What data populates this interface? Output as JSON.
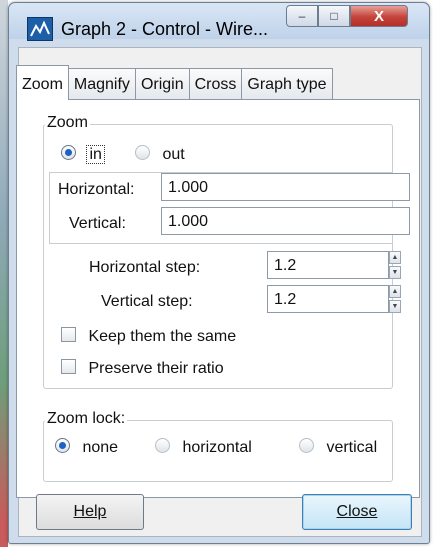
{
  "window": {
    "title": "Graph 2 - Control - Wire...",
    "controls": {
      "minimize": "–",
      "maximize": "□",
      "close": "X"
    }
  },
  "tabs": [
    {
      "label": "Zoom",
      "active": true
    },
    {
      "label": "Magnify",
      "active": false
    },
    {
      "label": "Origin",
      "active": false
    },
    {
      "label": "Cross",
      "active": false
    },
    {
      "label": "Graph type",
      "active": false
    }
  ],
  "zoom_group": {
    "legend": "Zoom",
    "direction": {
      "in_label": "in",
      "out_label": "out",
      "selected": "in"
    },
    "horizontal": {
      "label": "Horizontal:",
      "value": "1.000"
    },
    "vertical": {
      "label": "Vertical:",
      "value": "1.000"
    },
    "horizontal_step": {
      "label": "Horizontal step:",
      "value": "1.2"
    },
    "vertical_step": {
      "label": "Vertical step:",
      "value": "1.2"
    },
    "keep_same": {
      "label": "Keep them the same",
      "checked": false
    },
    "preserve_ratio": {
      "label": "Preserve their ratio",
      "checked": false
    }
  },
  "zoom_lock": {
    "legend": "Zoom lock:",
    "options": {
      "none": "none",
      "horizontal": "horizontal",
      "vertical": "vertical"
    },
    "selected": "none"
  },
  "buttons": {
    "help": "Help",
    "close": "Close"
  },
  "colors": {
    "accent_radio": "#1d60c8",
    "title_bar": "#bfd2ea",
    "close_button": "#c4433a"
  }
}
